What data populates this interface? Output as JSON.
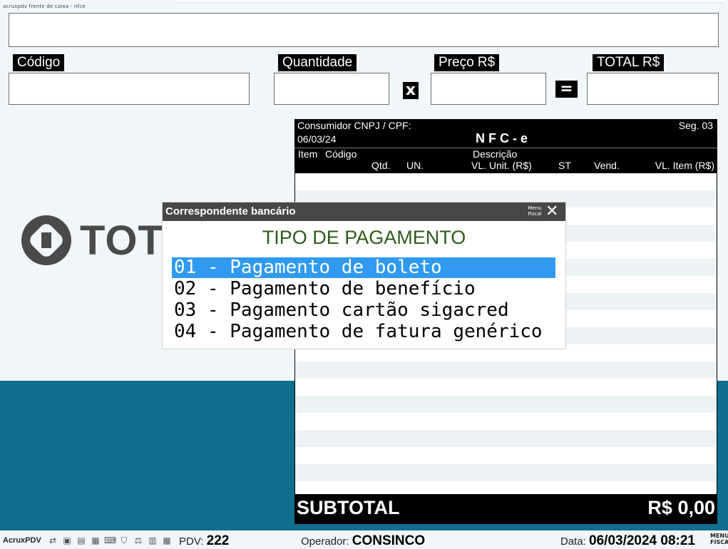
{
  "top": {
    "tiny_text": "acruxpdv frente de caixa - nfce"
  },
  "fields": {
    "codigo_label": "Código",
    "quantidade_label": "Quantidade",
    "preco_label": "Preço R$",
    "total_label": "TOTAL R$",
    "multiply_op": "x",
    "equals_op": "="
  },
  "logo": {
    "text": "TOTV"
  },
  "receipt": {
    "consumidor": "Consumidor CNPJ / CPF:",
    "segment": "Seg. 03",
    "date": "06/03/24",
    "title": "NFC-e",
    "col_item": "Item",
    "col_codigo": "Código",
    "col_descricao": "Descrição",
    "col_qtd": "Qtd.",
    "col_un": "UN.",
    "col_vl_unit": "VL. Unit. (R$)",
    "col_st": "ST",
    "col_vend": "Vend.",
    "col_vl_item": "VL. Item (R$)",
    "subtotal_label": "SUBTOTAL",
    "subtotal_value": "R$ 0,00"
  },
  "dialog": {
    "title": "Correspondente bancário",
    "menu_fiscal": "Menu Fiscal",
    "close_icon": "close-icon",
    "heading": "TIPO DE PAGAMENTO",
    "options": [
      {
        "label": "01 - Pagamento de boleto",
        "selected": true
      },
      {
        "label": "02 - Pagamento de benefício",
        "selected": false
      },
      {
        "label": "03 - Pagamento cartão sigacred",
        "selected": false
      },
      {
        "label": "04 - Pagamento de fatura genérico",
        "selected": false
      }
    ],
    "selected_color": "#2f9af0"
  },
  "status": {
    "app_name": "AcruxPDV",
    "pdv_label": "PDV:",
    "pdv_value": "222",
    "operador_label": "Operador:",
    "operador_value": "CONSINCO",
    "data_label": "Data:",
    "data_value": "06/03/2024 08:21",
    "menu_fiscal": "MENU FISCAL",
    "icons": [
      "network-icon",
      "computer-icon",
      "monitor-icon",
      "printer-icon",
      "keyboard-icon",
      "shield-icon",
      "scale-icon",
      "card-reader-icon",
      "barcode-icon"
    ]
  },
  "colors": {
    "background": "#f1f7f9",
    "bottom_band": "#106e8f",
    "dialog_title_bg": "#474747",
    "heading_green": "#2f5a1a"
  }
}
